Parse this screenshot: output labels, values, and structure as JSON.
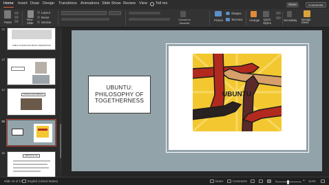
{
  "ribbon_tabs": [
    {
      "label": "Home",
      "active": true
    },
    {
      "label": "Insert"
    },
    {
      "label": "Draw"
    },
    {
      "label": "Design"
    },
    {
      "label": "Transitions"
    },
    {
      "label": "Animations"
    },
    {
      "label": "Slide Show"
    },
    {
      "label": "Review"
    },
    {
      "label": "View"
    }
  ],
  "tell_me": "Tell me",
  "share_label": "Share",
  "comments_label": "Comments",
  "toolbar": {
    "paste": "Paste",
    "new_slide": "New Slide",
    "layout": "Layout",
    "reset": "Reset",
    "section": "Section",
    "picture": "Picture",
    "shapes": "Shapes",
    "text_box": "Text Box",
    "convert_to_smartart": "Convert to SmartArt",
    "arrange": "Arrange",
    "quick_styles": "Quick Styles",
    "sensitivity": "Sensitivity",
    "design_ideas": "Design Ideas"
  },
  "thumbnails": [
    {
      "number": "12",
      "text": "PUBLIC FORUM FOR UBUNTU DESCRIPTION"
    },
    {
      "number": "13",
      "text": ""
    },
    {
      "number": "14",
      "text": "FORUM FOR FINDINGS"
    },
    {
      "number": "15",
      "text": "",
      "selected": true
    },
    {
      "number": "16",
      "text": "UBUNTU IN ITS"
    }
  ],
  "slide": {
    "title": "UBUNTU:\nPHILOSOPHY OF\nTOGETHERNESS",
    "image_text": "UBUNTU"
  },
  "status": {
    "slide_counter": "Slide 15 of 17",
    "language": "English (United States)",
    "notes": "Notes",
    "comments": "Comments",
    "zoom": "114%"
  },
  "colors": {
    "accent": "#c03b2b",
    "slide_bg": "#93a3aa",
    "art_yellow": "#f3c730",
    "art_red": "#b22a1e"
  }
}
